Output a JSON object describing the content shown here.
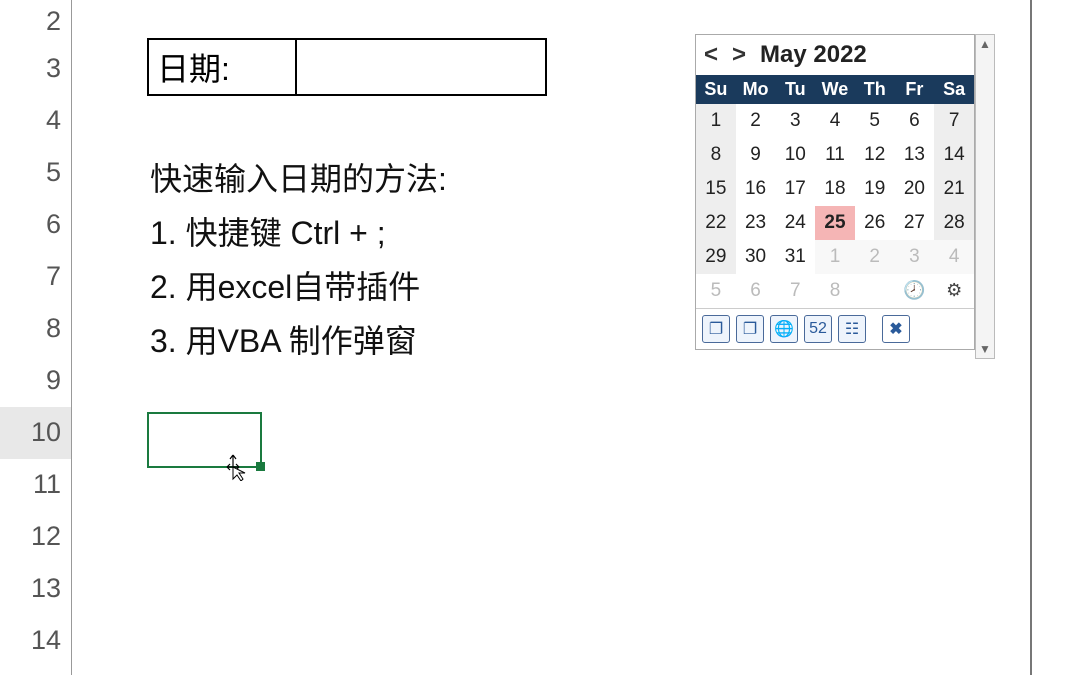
{
  "rows": [
    "2",
    "3",
    "4",
    "5",
    "6",
    "7",
    "8",
    "9",
    "10",
    "11",
    "12",
    "13",
    "14"
  ],
  "active_row": "10",
  "date_label": "日期:",
  "date_value": "",
  "text": {
    "heading": "快速输入日期的方法:",
    "line1": "1. 快捷键 Ctrl + ;",
    "line2": "2. 用excel自带插件",
    "line3": "3. 用VBA 制作弹窗"
  },
  "calendar": {
    "prev": "<",
    "next": ">",
    "title": "May 2022",
    "weekdays": [
      "Su",
      "Mo",
      "Tu",
      "We",
      "Th",
      "Fr",
      "Sa"
    ],
    "days": [
      {
        "n": "1",
        "t": "cur",
        "wk": true
      },
      {
        "n": "2",
        "t": "cur"
      },
      {
        "n": "3",
        "t": "cur"
      },
      {
        "n": "4",
        "t": "cur"
      },
      {
        "n": "5",
        "t": "cur"
      },
      {
        "n": "6",
        "t": "cur"
      },
      {
        "n": "7",
        "t": "cur",
        "wk": true
      },
      {
        "n": "8",
        "t": "cur",
        "wk": true
      },
      {
        "n": "9",
        "t": "cur"
      },
      {
        "n": "10",
        "t": "cur"
      },
      {
        "n": "11",
        "t": "cur"
      },
      {
        "n": "12",
        "t": "cur"
      },
      {
        "n": "13",
        "t": "cur"
      },
      {
        "n": "14",
        "t": "cur",
        "wk": true
      },
      {
        "n": "15",
        "t": "cur",
        "wk": true
      },
      {
        "n": "16",
        "t": "cur"
      },
      {
        "n": "17",
        "t": "cur"
      },
      {
        "n": "18",
        "t": "cur"
      },
      {
        "n": "19",
        "t": "cur"
      },
      {
        "n": "20",
        "t": "cur"
      },
      {
        "n": "21",
        "t": "cur",
        "wk": true
      },
      {
        "n": "22",
        "t": "cur",
        "wk": true
      },
      {
        "n": "23",
        "t": "cur"
      },
      {
        "n": "24",
        "t": "cur"
      },
      {
        "n": "25",
        "t": "today"
      },
      {
        "n": "26",
        "t": "cur"
      },
      {
        "n": "27",
        "t": "cur"
      },
      {
        "n": "28",
        "t": "cur",
        "wk": true
      },
      {
        "n": "29",
        "t": "cur",
        "wk": true
      },
      {
        "n": "30",
        "t": "cur"
      },
      {
        "n": "31",
        "t": "cur"
      },
      {
        "n": "1",
        "t": "next"
      },
      {
        "n": "2",
        "t": "next"
      },
      {
        "n": "3",
        "t": "next"
      },
      {
        "n": "4",
        "t": "next",
        "wk": true
      }
    ],
    "footer_extra": [
      "5",
      "6",
      "7",
      "8"
    ],
    "clock_icon": "🕗",
    "gear_icon": "⚙"
  },
  "toolbar": {
    "win1": "❐",
    "win2": "❐",
    "globe": "🌐",
    "num": "52",
    "cal": "☷",
    "close": "✖"
  }
}
